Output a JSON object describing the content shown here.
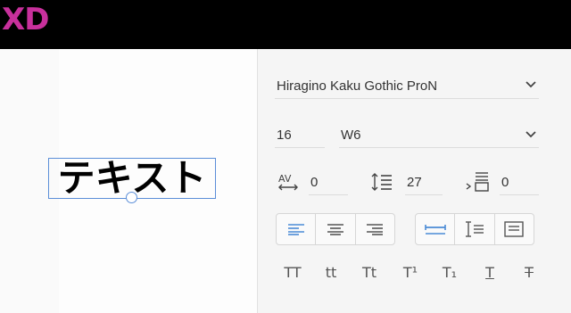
{
  "app": {
    "logo_text": "XD",
    "logo_color": "#c8309c"
  },
  "canvas": {
    "text_content": "テキスト",
    "selection_color": "#5b8ed8"
  },
  "text_panel": {
    "font_family": "Hiragino Kaku Gothic ProN",
    "font_size": "16",
    "font_weight": "W6",
    "character_spacing": "0",
    "line_spacing": "27",
    "paragraph_spacing": "0",
    "selected_alignment": "left",
    "accent_color": "#4b8bd6",
    "alignment_buttons": [
      "align-left-icon",
      "align-center-icon",
      "align-right-icon"
    ],
    "text_box_buttons": [
      "auto-width-icon",
      "auto-height-icon",
      "fixed-size-icon"
    ],
    "transform_buttons": [
      "TT",
      "tt",
      "Tt",
      "T¹",
      "T₁",
      "T",
      "T"
    ]
  }
}
